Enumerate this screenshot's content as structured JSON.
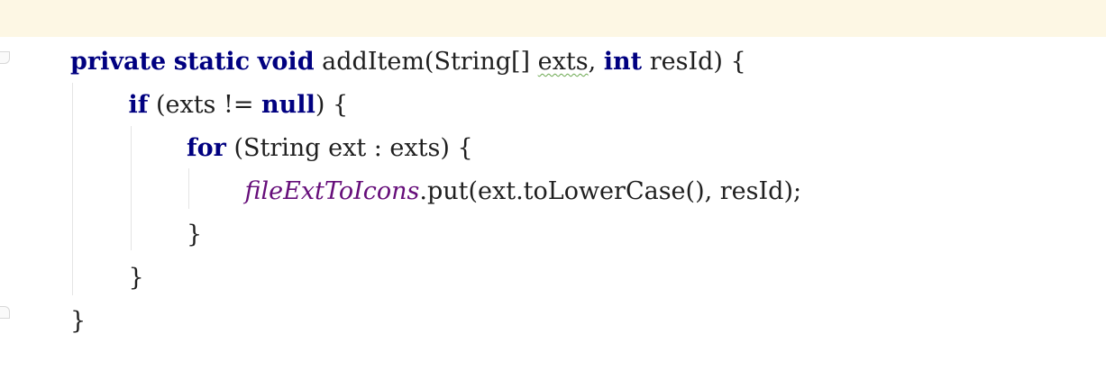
{
  "editor": {
    "lines": [
      {
        "indent": 0,
        "tokens": [
          {
            "type": "kw",
            "text": "private"
          },
          {
            "type": "plain",
            "text": " "
          },
          {
            "type": "kw",
            "text": "static"
          },
          {
            "type": "plain",
            "text": " "
          },
          {
            "type": "kw",
            "text": "void"
          },
          {
            "type": "plain",
            "text": " addItem(String[] "
          },
          {
            "type": "param-warn",
            "text": "exts"
          },
          {
            "type": "plain",
            "text": ", "
          },
          {
            "type": "kw",
            "text": "int"
          },
          {
            "type": "plain",
            "text": " resId) {"
          }
        ]
      },
      {
        "indent": 1,
        "tokens": [
          {
            "type": "kw",
            "text": "if"
          },
          {
            "type": "plain",
            "text": " (exts != "
          },
          {
            "type": "kw",
            "text": "null"
          },
          {
            "type": "plain",
            "text": ") {"
          }
        ]
      },
      {
        "indent": 2,
        "tokens": [
          {
            "type": "kw",
            "text": "for"
          },
          {
            "type": "plain",
            "text": " (String ext : exts) {"
          }
        ]
      },
      {
        "indent": 3,
        "tokens": [
          {
            "type": "field",
            "text": "fileExtToIcons"
          },
          {
            "type": "plain",
            "text": ".put(ext.toLowerCase(), resId);"
          }
        ]
      },
      {
        "indent": 2,
        "tokens": [
          {
            "type": "plain",
            "text": "}"
          }
        ]
      },
      {
        "indent": 1,
        "tokens": [
          {
            "type": "plain",
            "text": "}"
          }
        ]
      },
      {
        "indent": 0,
        "tokens": [
          {
            "type": "plain",
            "text": "}"
          }
        ]
      }
    ]
  },
  "colors": {
    "keyword": "#000080",
    "field": "#660e7a",
    "text": "#1f1f1f",
    "highlight_bar": "#fdf7e4",
    "warning_underline": "#6aa84f"
  }
}
